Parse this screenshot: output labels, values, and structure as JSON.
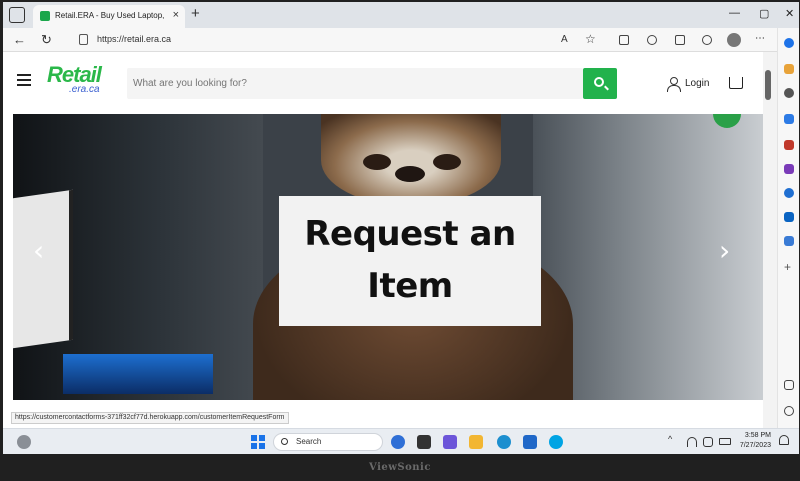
{
  "browser": {
    "tab_title": "Retail.ERA - Buy Used Laptop, Re",
    "tab_close": "×",
    "new_tab": "+",
    "window_controls": [
      "—",
      "▢",
      "✕"
    ],
    "url": "https://retail.era.ca",
    "nav": {
      "back": "←",
      "reload": "↻"
    },
    "read_aloud": "A",
    "favorite": "☆"
  },
  "site": {
    "logo_brand": "Retail",
    "logo_sub": ".era.ca",
    "search_placeholder": "What are you looking for?",
    "login_label": "Login",
    "accent_color": "#22b24c"
  },
  "hero": {
    "sign_line1": "Request an",
    "sign_line2": "Item",
    "prev_arrow": "‹",
    "next_arrow": "›"
  },
  "status_link": "https://customercontactforms-371ff32cf77d.herokuapp.com/customerItemRequestForm",
  "taskbar": {
    "search_label": "Search",
    "time": "3:58 PM",
    "date": "7/27/2023"
  },
  "bezel_brand": "ViewSonic",
  "icons": [
    "menu-icon",
    "search-icon",
    "user-icon",
    "cart-icon",
    "windows-logo-icon",
    "bell-icon"
  ]
}
